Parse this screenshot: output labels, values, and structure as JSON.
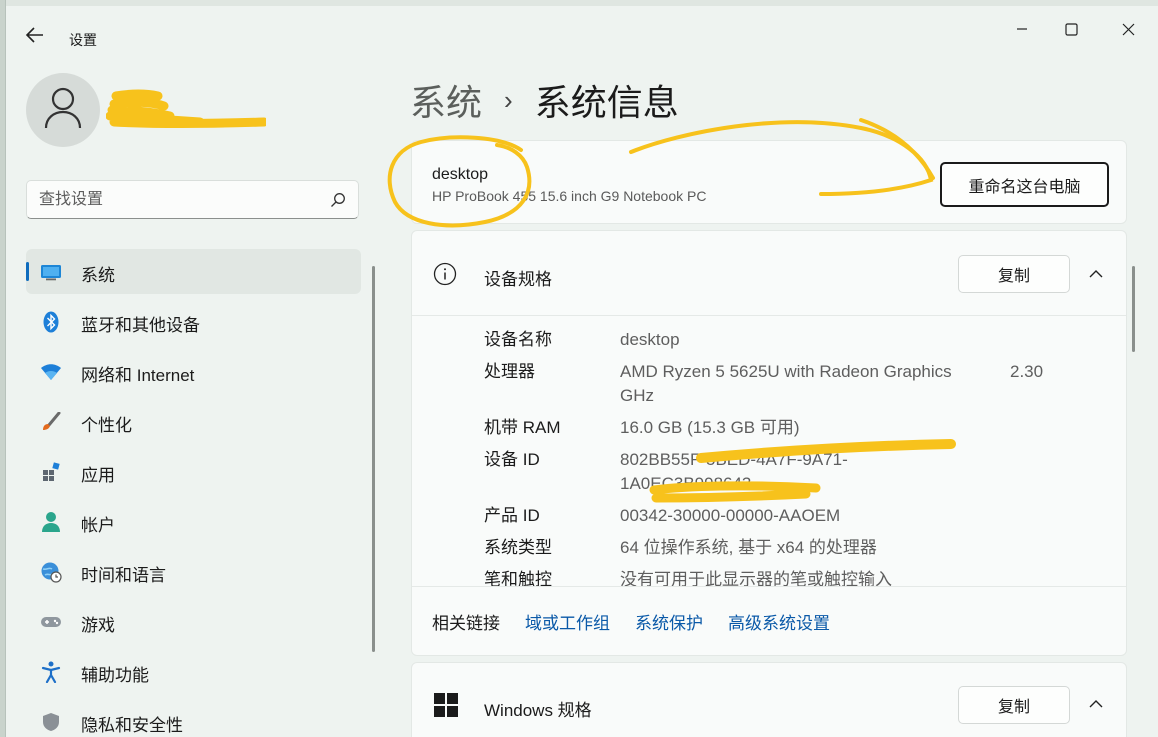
{
  "window": {
    "app_title": "设置",
    "controls": {
      "minimize": "—",
      "maximize": "☐",
      "close": "✕"
    }
  },
  "user": {
    "avatar_icon": "person-icon"
  },
  "search": {
    "placeholder": "查找设置",
    "value": ""
  },
  "sidebar": {
    "items": [
      {
        "label": "系统",
        "icon": "system-icon",
        "selected": true
      },
      {
        "label": "蓝牙和其他设备",
        "icon": "bluetooth-icon"
      },
      {
        "label": "网络和 Internet",
        "icon": "wifi-icon"
      },
      {
        "label": "个性化",
        "icon": "brush-icon"
      },
      {
        "label": "应用",
        "icon": "apps-icon"
      },
      {
        "label": "帐户",
        "icon": "account-icon"
      },
      {
        "label": "时间和语言",
        "icon": "globe-clock-icon"
      },
      {
        "label": "游戏",
        "icon": "gamepad-icon"
      },
      {
        "label": "辅助功能",
        "icon": "accessibility-icon"
      },
      {
        "label": "隐私和安全性",
        "icon": "shield-icon"
      }
    ]
  },
  "breadcrumb": {
    "parent": "系统",
    "separator": "›",
    "current": "系统信息"
  },
  "device_card": {
    "name": "desktop",
    "model": "HP ProBook 455 15.6 inch G9 Notebook PC",
    "rename_label": "重命名这台电脑"
  },
  "device_specs": {
    "title": "设备规格",
    "copy_label": "复制",
    "rows": [
      {
        "key": "设备名称",
        "value": "desktop"
      },
      {
        "key": "处理器",
        "value": "AMD Ryzen 5 5625U with Radeon Graphics GHz",
        "extra": "2.30"
      },
      {
        "key": "机带 RAM",
        "value": "16.0 GB (15.3 GB 可用)"
      },
      {
        "key": "设备 ID",
        "value": "802BB55F-5BED-4A7F-9A71-1A0EC3B998643"
      },
      {
        "key": "产品 ID",
        "value": "00342-30000-00000-AAOEM"
      },
      {
        "key": "系统类型",
        "value": "64 位操作系统, 基于 x64 的处理器"
      },
      {
        "key": "笔和触控",
        "value": "没有可用于此显示器的笔或触控输入"
      }
    ]
  },
  "related_links": {
    "label": "相关链接",
    "links": [
      "域或工作组",
      "系统保护",
      "高级系统设置"
    ]
  },
  "windows_specs": {
    "title": "Windows 规格",
    "copy_label": "复制"
  },
  "colors": {
    "accent": "#0f6cbd",
    "link": "#0a59a8",
    "annotation": "#f7c21c"
  }
}
